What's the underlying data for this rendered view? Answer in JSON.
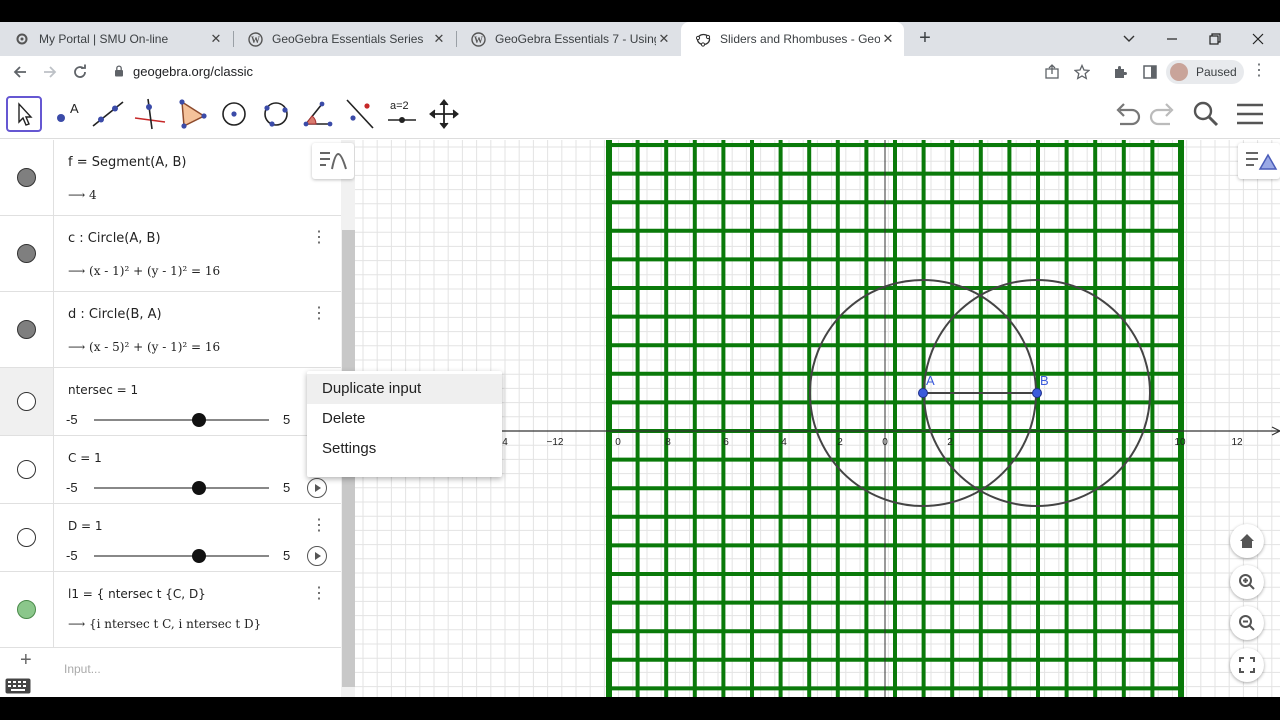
{
  "browser": {
    "tabs": [
      {
        "title": "My Portal | SMU On-line",
        "favicon": "gear-icon"
      },
      {
        "title": "GeoGebra Essentials Series",
        "favicon": "wordpress-icon"
      },
      {
        "title": "GeoGebra Essentials 7 - Using th",
        "favicon": "wordpress-icon"
      },
      {
        "title": "Sliders and Rhombuses - GeoGe",
        "favicon": "geogebra-icon",
        "active": true
      }
    ],
    "close_glyph": "✕",
    "new_tab_glyph": "+",
    "url": "geogebra.org/classic",
    "profile_status": "Paused"
  },
  "algebra": {
    "items": [
      {
        "def": "f  =  Segment(A, B)",
        "value": "⟶  4",
        "color": "#7f7f7f"
      },
      {
        "def": "c : Circle(A, B)",
        "value": "⟶  (x - 1)² + (y - 1)² = 16",
        "color": "#7f7f7f"
      },
      {
        "def": "d : Circle(B, A)",
        "value": "⟶  (x - 5)² + (y - 1)² = 16",
        "color": "#7f7f7f"
      }
    ],
    "sliders": [
      {
        "def": "ntersec  =  1",
        "min": "-5",
        "max": "5",
        "value": 1,
        "range": [
          -5,
          5
        ]
      },
      {
        "def": "C  =  1",
        "min": "-5",
        "max": "5",
        "value": 1,
        "range": [
          -5,
          5
        ]
      },
      {
        "def": "D  =  1",
        "min": "-5",
        "max": "5",
        "value": 1,
        "range": [
          -5,
          5
        ]
      }
    ],
    "last": {
      "def": "l1  =  { ntersec t {C, D}",
      "value": "⟶  {i ntersec t C, i ntersec t D}",
      "color": "#8bc78b"
    },
    "input_placeholder": "Input..."
  },
  "context_menu": {
    "items": [
      "Duplicate input",
      "Delete",
      "Settings"
    ]
  },
  "toolbar": {
    "tools": [
      "move-tool",
      "point-tool",
      "line-tool",
      "perpendicular-tool",
      "polygon-tool",
      "circle-tool",
      "conic-tool",
      "angle-tool",
      "reflect-tool",
      "slider-tool",
      "move-graphics-tool"
    ],
    "slider_label": "a=2"
  },
  "graphics": {
    "x_labels": [
      "4",
      "−12",
      "0",
      "8",
      "6",
      "4",
      "2",
      "0",
      "2",
      "10",
      "12"
    ],
    "point_labels": [
      "A",
      "B"
    ],
    "grid_color": "#0a7a0a",
    "circle_color": "#444444",
    "point_color": "#3b5bdb"
  }
}
